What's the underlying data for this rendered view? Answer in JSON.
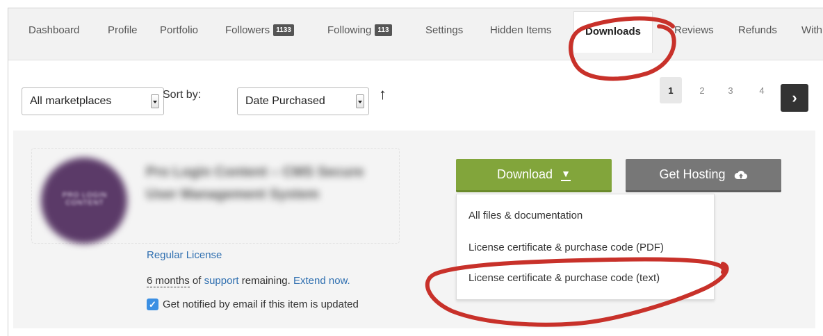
{
  "tabs": [
    {
      "label": "Dashboard"
    },
    {
      "label": "Profile"
    },
    {
      "label": "Portfolio"
    },
    {
      "label": "Followers",
      "badge": "1133"
    },
    {
      "label": "Following",
      "badge": "113"
    },
    {
      "label": "Settings"
    },
    {
      "label": "Hidden Items"
    },
    {
      "label": "Downloads",
      "active": true
    },
    {
      "label": "Reviews"
    },
    {
      "label": "Refunds"
    },
    {
      "label": "With"
    }
  ],
  "filters": {
    "marketplace": "All marketplaces",
    "sort_label": "Sort by:",
    "sort_value": "Date Purchased",
    "sort_direction_icon": "arrow-up-icon"
  },
  "pagination": {
    "pages": [
      "1",
      "2",
      "3",
      "4"
    ],
    "current": "1",
    "next_label": "›"
  },
  "item": {
    "title": "Pro Login Content – CMS Secure User Management System",
    "thumbnail_text": "PRO LOGIN CONTENT",
    "license": "Regular License",
    "support": {
      "duration": "6 months",
      "of_text": "of",
      "support_link": "support",
      "remaining_text": "remaining.",
      "extend_link": "Extend now."
    },
    "notify_label": "Get notified by email if this item is updated",
    "notify_checked": true
  },
  "actions": {
    "download_label": "Download",
    "hosting_label": "Get Hosting"
  },
  "download_menu": [
    "All files & documentation",
    "License certificate & purchase code (PDF)",
    "License certificate & purchase code (text)"
  ],
  "colors": {
    "download_button": "#82a53b",
    "hosting_button": "#777777",
    "link": "#2f6fb0",
    "annotation": "#c8312a"
  }
}
